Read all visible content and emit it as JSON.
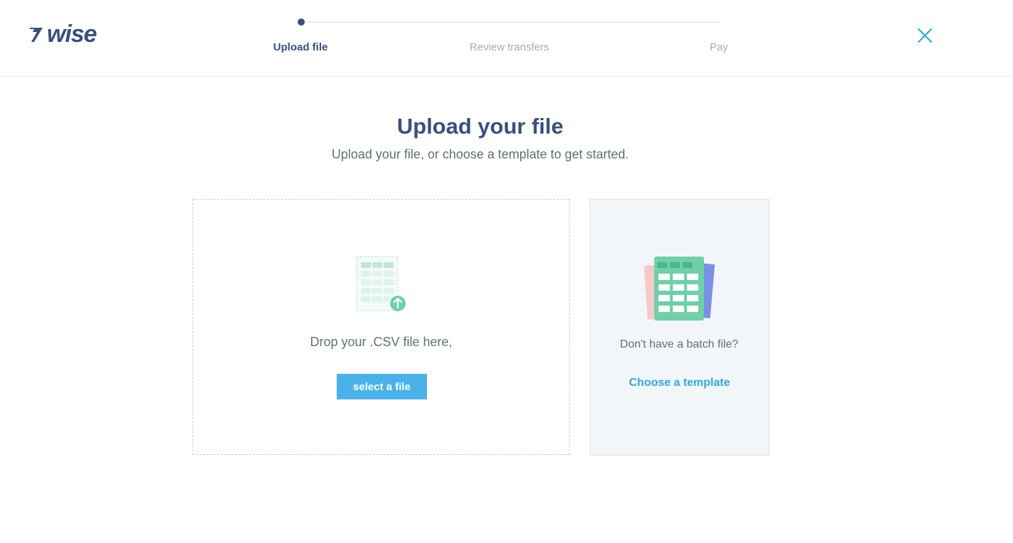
{
  "header": {
    "logo_text": "WISE",
    "brand_color": "#37517e",
    "steps": [
      {
        "label": "Upload file",
        "state": "active"
      },
      {
        "label": "Review transfers",
        "state": "inactive"
      },
      {
        "label": "Pay",
        "state": "inactive"
      }
    ],
    "close_icon": "close-icon"
  },
  "main": {
    "title": "Upload your file",
    "subtitle": "Upload your file, or choose a template to get started."
  },
  "drop_zone": {
    "icon": "csv-upload-icon",
    "text": "Drop your .CSV file here,",
    "button_label": "select a file",
    "button_color": "#4ab2ea"
  },
  "template_card": {
    "icon": "spreadsheet-templates-icon",
    "text": "Don't have a batch file?",
    "link_label": "Choose a template",
    "link_color": "#2ea8de"
  }
}
